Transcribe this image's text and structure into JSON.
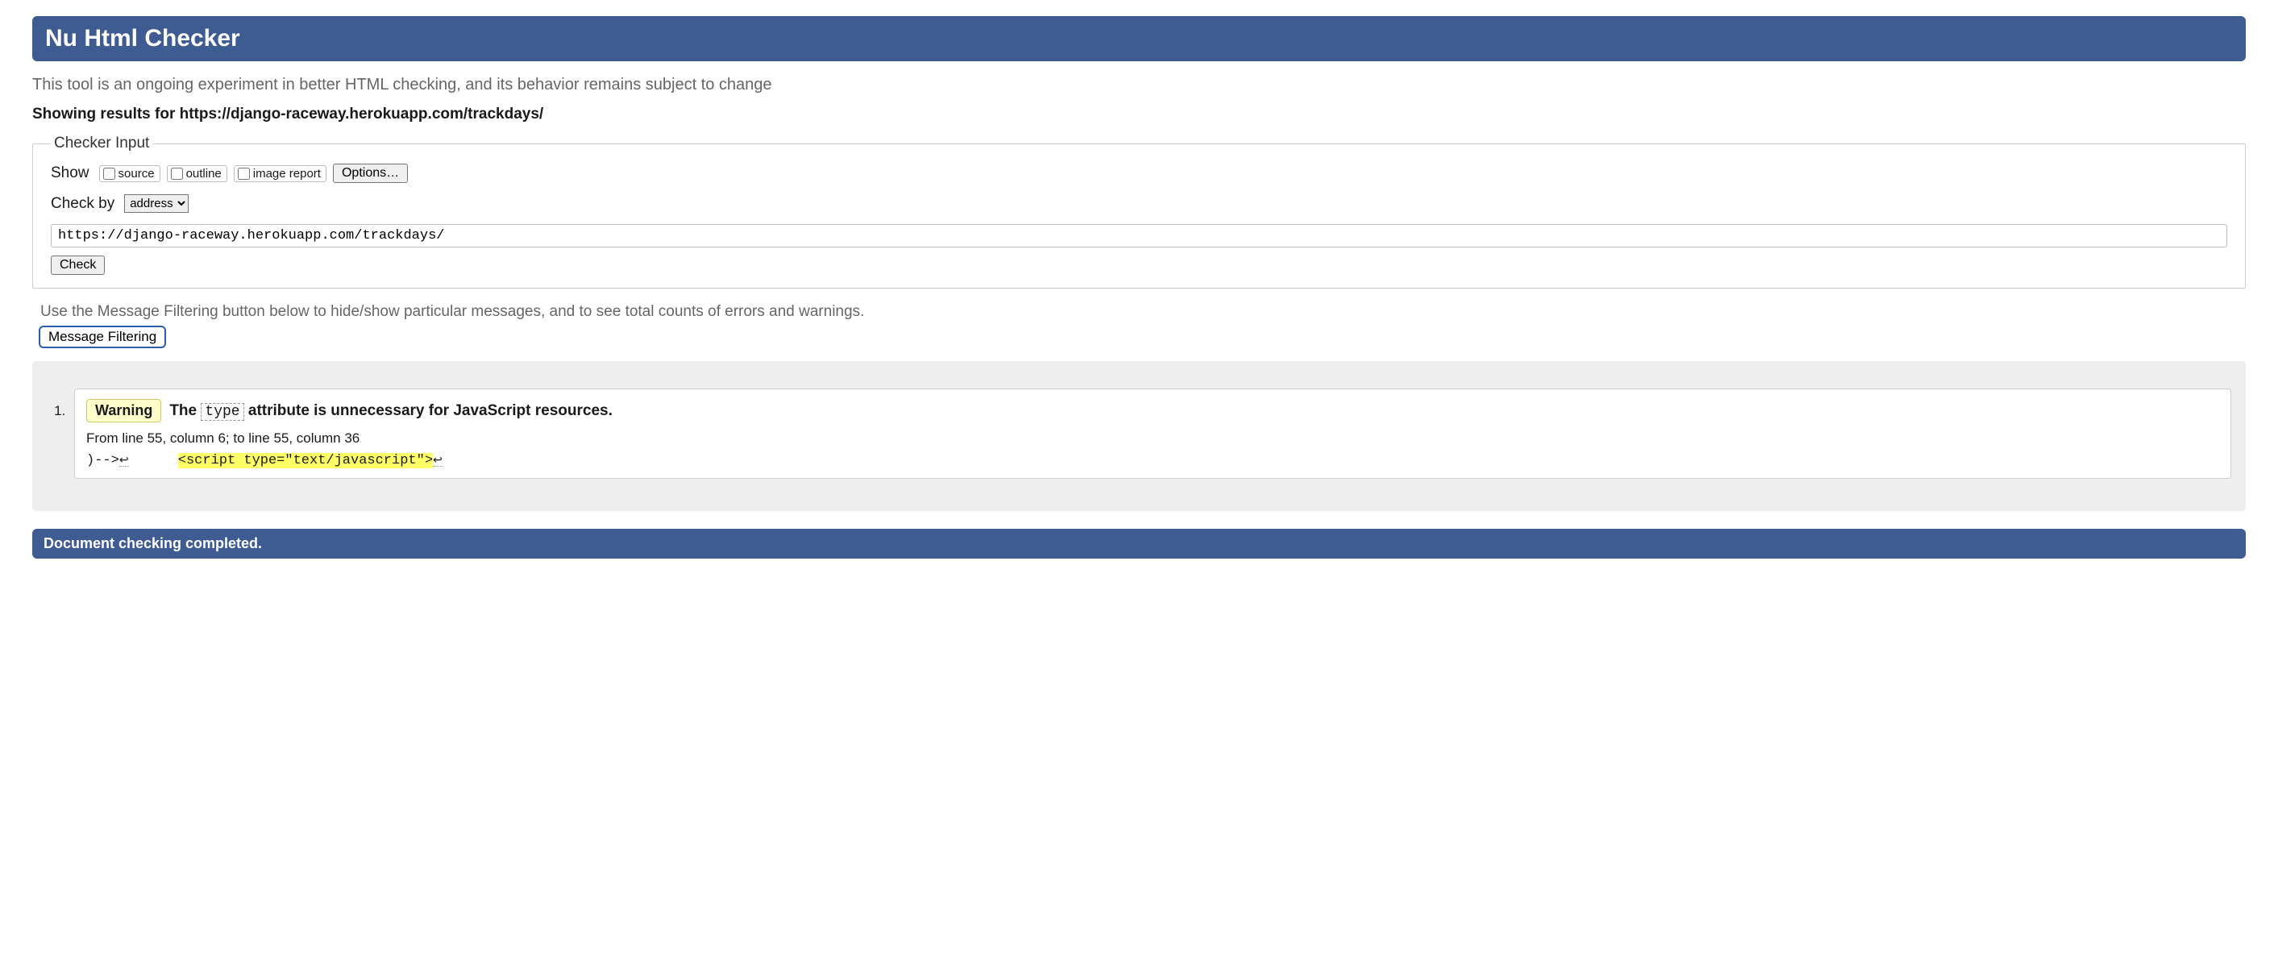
{
  "header": {
    "title": "Nu Html Checker"
  },
  "subtitle": "This tool is an ongoing experiment in better HTML checking, and its behavior remains subject to change",
  "showing": {
    "prefix": "Showing results for ",
    "url": "https://django-raceway.herokuapp.com/trackdays/"
  },
  "checker_input": {
    "legend": "Checker Input",
    "show_label": "Show",
    "chk_source": "source",
    "chk_outline": "outline",
    "chk_image": "image report",
    "options_btn": "Options…",
    "check_by_label": "Check by",
    "check_by_value": "address",
    "address_value": "https://django-raceway.herokuapp.com/trackdays/",
    "check_btn": "Check"
  },
  "filtering": {
    "hint": "Use the Message Filtering button below to hide/show particular messages, and to see total counts of errors and warnings.",
    "btn": "Message Filtering"
  },
  "messages": [
    {
      "severity": "Warning",
      "text_pre": "The ",
      "attr": "type",
      "text_post": " attribute is unnecessary for JavaScript resources.",
      "location": "From line 55, column 6; to line 55, column 36",
      "extract_pre": ")-->",
      "extract_gap": "      ",
      "extract_hl": "<script type=\"text/javascript\">"
    }
  ],
  "footer": {
    "status": "Document checking completed."
  }
}
